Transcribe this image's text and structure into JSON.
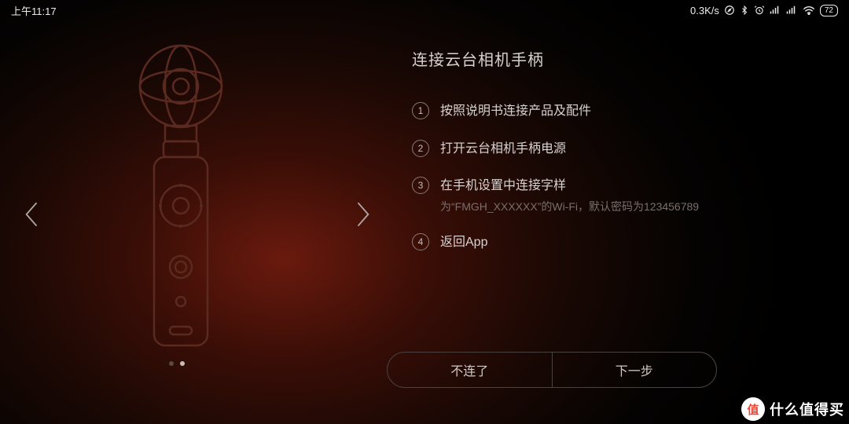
{
  "status": {
    "time": "上午11:17",
    "net_speed": "0.3K/s",
    "battery": "72"
  },
  "page": {
    "dots_count": 2,
    "active_dot_index": 1
  },
  "panel": {
    "title": "连接云台相机手柄",
    "steps": [
      {
        "num": "1",
        "text": "按照说明书连接产品及配件"
      },
      {
        "num": "2",
        "text": "打开云台相机手柄电源"
      },
      {
        "num": "3",
        "text": "在手机设置中连接字样",
        "sub": "为“FMGH_XXXXXX”的Wi-Fi，默认密码为123456789"
      },
      {
        "num": "4",
        "text": "返回App"
      }
    ]
  },
  "buttons": {
    "cancel": "不连了",
    "next": "下一步"
  },
  "watermark": {
    "badge": "值",
    "text": "什么值得买"
  }
}
